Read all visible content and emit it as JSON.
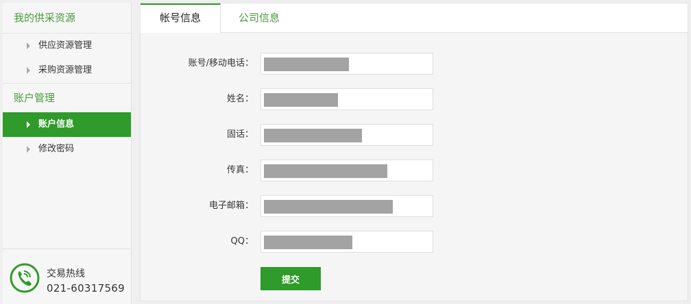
{
  "sidebar": {
    "section1_title": "我的供采资源",
    "section1_items": [
      "供应资源管理",
      "采购资源管理"
    ],
    "section2_title": "账户管理",
    "section2_items": [
      "账户信息",
      "修改密码"
    ],
    "active_item": "账户信息",
    "hotline": {
      "title": "交易热线",
      "number": "021-60317569"
    }
  },
  "tabs": [
    {
      "label": "帐号信息",
      "active": true
    },
    {
      "label": "公司信息",
      "active": false
    }
  ],
  "form": {
    "fields": [
      {
        "label": "账号/移动电话：",
        "value_hidden": true
      },
      {
        "label": "姓名：",
        "value_hidden": true
      },
      {
        "label": "固话：",
        "value_hidden": true
      },
      {
        "label": "传真：",
        "value_hidden": true
      },
      {
        "label": "电子邮箱：",
        "value_hidden": true
      },
      {
        "label": "QQ：",
        "value_hidden": true
      }
    ],
    "submit_label": "提交"
  },
  "colors": {
    "accent": "#2e9b2a",
    "accent_text": "#4a9a3a",
    "mask": "#a3a3a3"
  },
  "icons": {
    "hotline": "phone-icon",
    "nav_arrow": "triangle-right-icon"
  }
}
